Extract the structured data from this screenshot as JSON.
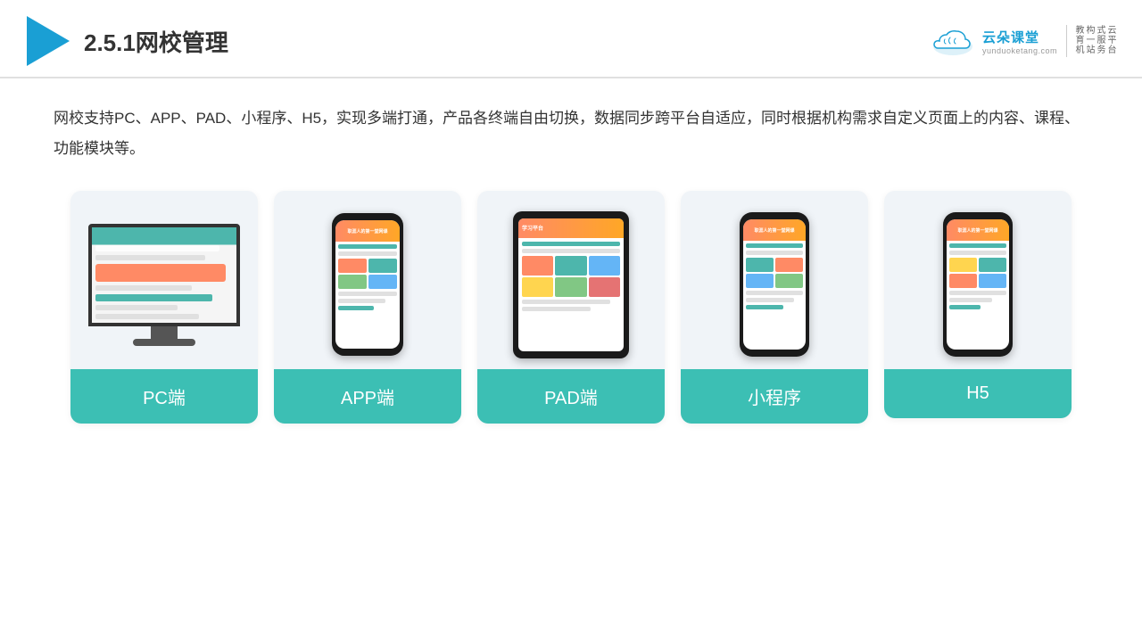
{
  "header": {
    "title": "2.5.1网校管理",
    "brand": {
      "name": "云朵课堂",
      "url": "yunduoketang.com",
      "slogan": "教育机构一站式服务云平台"
    }
  },
  "description": "网校支持PC、APP、PAD、小程序、H5，实现多端打通，产品各终端自由切换，数据同步跨平台自适应，同时根据机构需求自定义页面上的内容、课程、功能模块等。",
  "cards": [
    {
      "id": "pc",
      "label": "PC端"
    },
    {
      "id": "app",
      "label": "APP端"
    },
    {
      "id": "pad",
      "label": "PAD端"
    },
    {
      "id": "miniapp",
      "label": "小程序"
    },
    {
      "id": "h5",
      "label": "H5"
    }
  ]
}
